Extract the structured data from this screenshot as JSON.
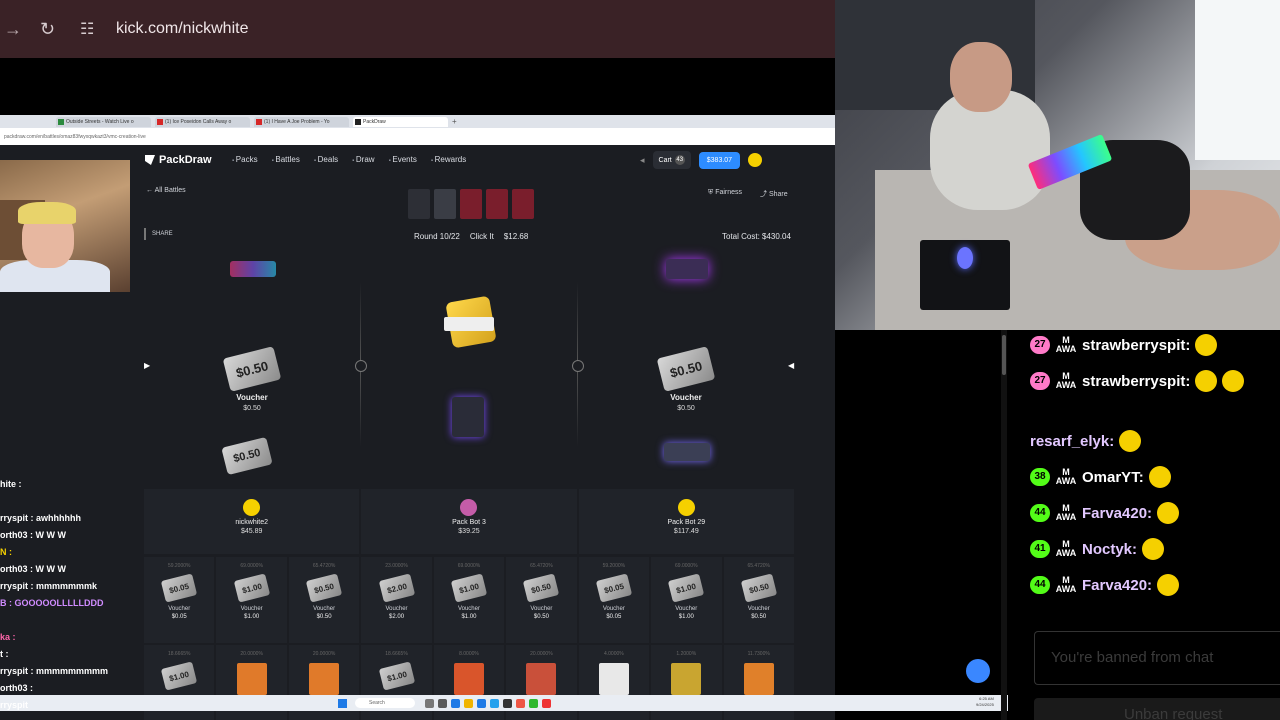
{
  "browser": {
    "url": "kick.com/nickwhite"
  },
  "inner_browser": {
    "tabs": [
      {
        "label": "Outside Streets - Watch Live o",
        "kind": "green"
      },
      {
        "label": "(1) Ice Poseidon Calls Away o",
        "kind": "yt"
      },
      {
        "label": "(1) I Have A Joe Problem - Yo",
        "kind": "yt"
      },
      {
        "label": "PackDraw",
        "kind": "pd",
        "active": true
      }
    ],
    "address": "packdraw.com/en/battles/omaz83fwyxqwkazt3/vmc-creation-live"
  },
  "packdraw": {
    "brand": "PackDraw",
    "nav": [
      "Packs",
      "Battles",
      "Deals",
      "Draw",
      "Events",
      "Rewards"
    ],
    "cart_label": "Cart",
    "cart_count": "43",
    "balance": "$383.07",
    "all_battles": "All Battles",
    "fairness": "Fairness",
    "share_top": "Share",
    "share_label": "SHARE",
    "round": "Round 10/22",
    "pack_name": "Click It",
    "pack_price": "$12.68",
    "total_cost": "Total Cost: $430.04",
    "slots": [
      {
        "voucher_text": "$0.50",
        "name": "Voucher",
        "price": "$0.50"
      },
      {
        "voucher_text": "$0.50",
        "name": "Voucher",
        "price": "$0.50"
      }
    ],
    "bottom_voucher": "$0.50",
    "players": [
      {
        "name": "nickwhite2",
        "value": "$45.89",
        "color": "#f5d000"
      },
      {
        "name": "Pack Bot 3",
        "value": "$39.25",
        "color": "#c45ca8"
      },
      {
        "name": "Pack Bot 29",
        "value": "$117.49",
        "color": "#f5d000"
      }
    ],
    "results_row1": [
      {
        "pct": "59.2000%",
        "v": "$0.05",
        "name": "Voucher",
        "val": "$0.05"
      },
      {
        "pct": "69.0000%",
        "v": "$1.00",
        "name": "Voucher",
        "val": "$1.00"
      },
      {
        "pct": "65.4720%",
        "v": "$0.50",
        "name": "Voucher",
        "val": "$0.50"
      },
      {
        "pct": "23.0000%",
        "v": "$2.00",
        "name": "Voucher",
        "val": "$2.00"
      },
      {
        "pct": "69.0000%",
        "v": "$1.00",
        "name": "Voucher",
        "val": "$1.00"
      },
      {
        "pct": "65.4720%",
        "v": "$0.50",
        "name": "Voucher",
        "val": "$0.50"
      },
      {
        "pct": "59.2000%",
        "v": "$0.05",
        "name": "Voucher",
        "val": "$0.05"
      },
      {
        "pct": "69.0000%",
        "v": "$1.00",
        "name": "Voucher",
        "val": "$1.00"
      },
      {
        "pct": "65.4720%",
        "v": "$0.50",
        "name": "Voucher",
        "val": "$0.50"
      }
    ],
    "results_row2": [
      {
        "pct": "18.6665%",
        "kind": "voucher",
        "v": "$1.00"
      },
      {
        "pct": "20.0000%",
        "kind": "card",
        "color": "#e07a2a"
      },
      {
        "pct": "20.0000%",
        "kind": "card",
        "color": "#e07a2a"
      },
      {
        "pct": "18.6665%",
        "kind": "voucher",
        "v": "$1.00"
      },
      {
        "pct": "8.0000%",
        "kind": "card",
        "color": "#d9552b"
      },
      {
        "pct": "20.0000%",
        "kind": "card",
        "color": "#c9503a"
      },
      {
        "pct": "4.0000%",
        "kind": "card",
        "color": "#e8e8e8"
      },
      {
        "pct": "1.2000%",
        "kind": "card",
        "color": "#c9a530"
      },
      {
        "pct": "11.7300%",
        "kind": "card",
        "color": "#e0802a"
      }
    ]
  },
  "taskbar": {
    "search": "Search",
    "time": "6:25 AM",
    "date": "9/24/2025"
  },
  "left_chat": [
    {
      "text": "hite : ",
      "color": "#ffffff"
    },
    {
      "text": "",
      "color": "#ffffff"
    },
    {
      "text": "rryspit : awhhhhhh",
      "color": "#ffffff"
    },
    {
      "text": "orth03 : W W W",
      "color": "#ffffff"
    },
    {
      "text": "N : ",
      "color": "#f5d000"
    },
    {
      "text": "orth03 : W W W",
      "color": "#ffffff"
    },
    {
      "text": "rryspit : mmmmmmmk",
      "color": "#ffffff"
    },
    {
      "text": "B : GOOOOOLLLLLDDD",
      "color": "#d08cff"
    },
    {
      "text": "",
      "color": "#ffffff"
    },
    {
      "text": "ka : ",
      "color": "#ff66aa"
    },
    {
      "text": "t : ",
      "color": "#ffffff"
    },
    {
      "text": "rryspit : mmmmmmmmm",
      "color": "#ffffff"
    },
    {
      "text": "orth03 : ",
      "color": "#ffffff"
    },
    {
      "text": "rryspit",
      "color": "#ffffff"
    }
  ],
  "right_chat": [
    {
      "badge": "27",
      "badge_color": "#ff7ac8",
      "user": "strawberryspit:",
      "color": "#ffffff",
      "emotes": 1
    },
    {
      "badge": "27",
      "badge_color": "#ff7ac8",
      "user": "strawberryspit:",
      "color": "#ffffff",
      "emotes": 2
    },
    {
      "badge": "",
      "badge_color": "",
      "user": "resarf_elyk:",
      "color": "#e2c8ff",
      "emotes": 1
    },
    {
      "badge": "38",
      "badge_color": "#53fc18",
      "user": "OmarYT:",
      "color": "#ffffff",
      "emotes": 1
    },
    {
      "badge": "44",
      "badge_color": "#53fc18",
      "user": "Farva420:",
      "color": "#e2c8ff",
      "emotes": 1
    },
    {
      "badge": "41",
      "badge_color": "#53fc18",
      "user": "Noctyk:",
      "color": "#e2c8ff",
      "emotes": 1
    },
    {
      "badge": "44",
      "badge_color": "#53fc18",
      "user": "Farva420:",
      "color": "#e2c8ff",
      "emotes": 1
    }
  ],
  "chat_input": {
    "banned": "You're banned from chat",
    "unban": "Unban request"
  }
}
